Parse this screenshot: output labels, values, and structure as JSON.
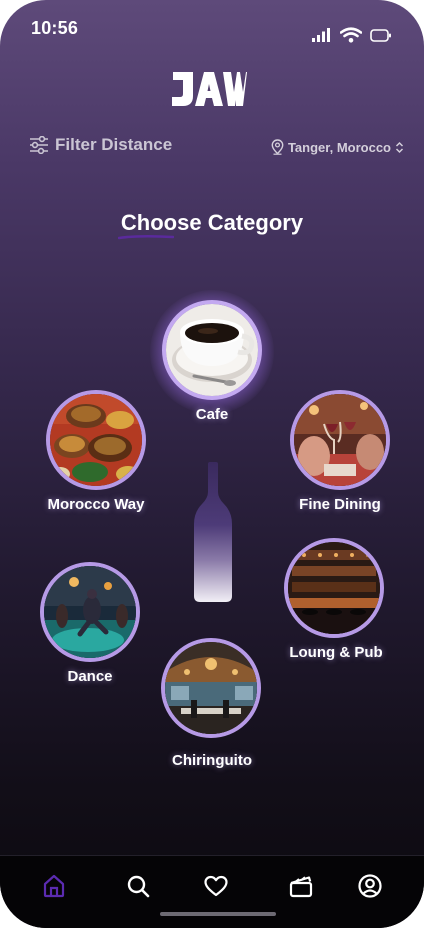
{
  "status_bar": {
    "time": "10:56"
  },
  "header": {
    "logo_text": "JAW",
    "filter_label": "Filter Distance",
    "location_label": "Tanger, Morocco"
  },
  "main": {
    "heading": "Choose Category",
    "categories": [
      {
        "label": "Cafe"
      },
      {
        "label": "Morocco Way"
      },
      {
        "label": "Fine Dining"
      },
      {
        "label": "Dance"
      },
      {
        "label": "Loung & Pub"
      },
      {
        "label": "Chiringuito"
      }
    ]
  },
  "bottom_nav": {
    "items": [
      {
        "icon": "home-icon",
        "active": true
      },
      {
        "icon": "search-icon"
      },
      {
        "icon": "heart-icon"
      },
      {
        "icon": "clapperboard-icon"
      },
      {
        "icon": "profile-icon"
      }
    ],
    "active_color": "#5b2bb0"
  },
  "colors": {
    "accent": "#b69ae6",
    "heading_underline": "#5a2a9c"
  }
}
